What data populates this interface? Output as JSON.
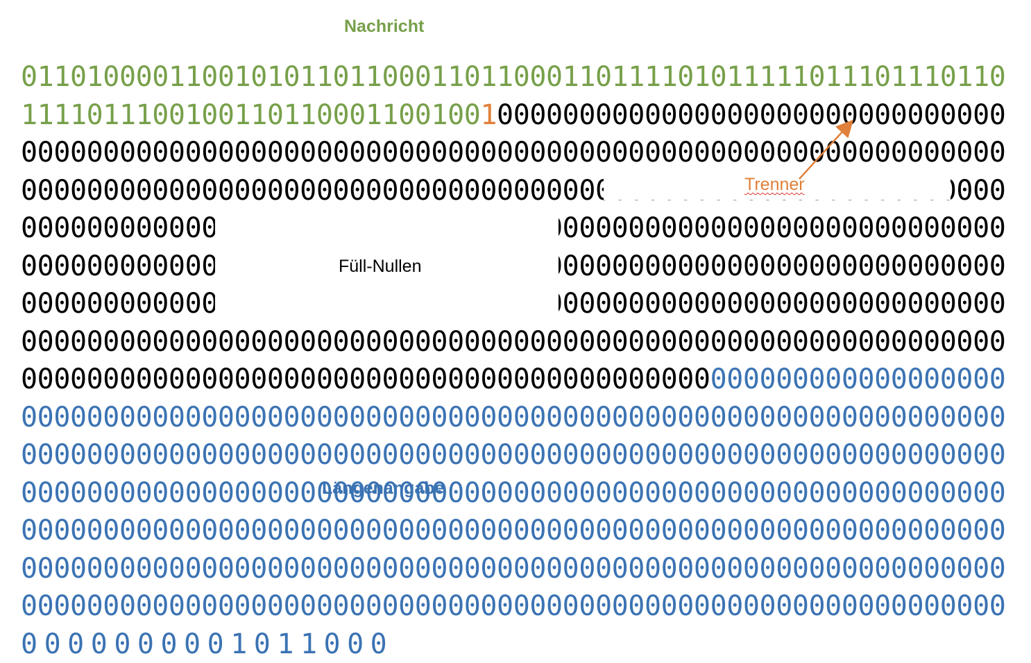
{
  "labels": {
    "message": "Nachricht",
    "separator": "Trenner",
    "padding": "Füll-Nullen",
    "length": "Längenangabe"
  },
  "colors": {
    "message": "#77a04a",
    "separator": "#e0803a",
    "padding": "#000000",
    "length": "#3b73b3"
  },
  "bits": {
    "message": "0110100001100101011011000110110001101111010111110111011101101111011100100110110001100100",
    "separator": "1",
    "padding": "0000000000000000000000000000000000000000000000000000000000000000000000000000000000000000000000000000000000000000000000000000000000000000000000000000000000000000000000000000000000000000000000000000000000000000000000000000000000000000000000000000000000000000000000000000000000000000000000000000000000000000000000000000000000000000000000000000000000000000000000000000000000000000000000000000000000000000000000000000000000000000000000000",
    "length": "0000000000000000000000000000000000000000000000000000000000000000000000000000000000000000000000000000000000000000000000000000000000000000000000000000000000000000000000000000000000000000000000000000000000000000000000000000000000000000000000000000000000000000000000000000000000000000000000000000000000000000000000000000000000000000000000000000000000000000000000000000000000000000000000000001011000"
  },
  "layout": {
    "per_line": 60
  }
}
